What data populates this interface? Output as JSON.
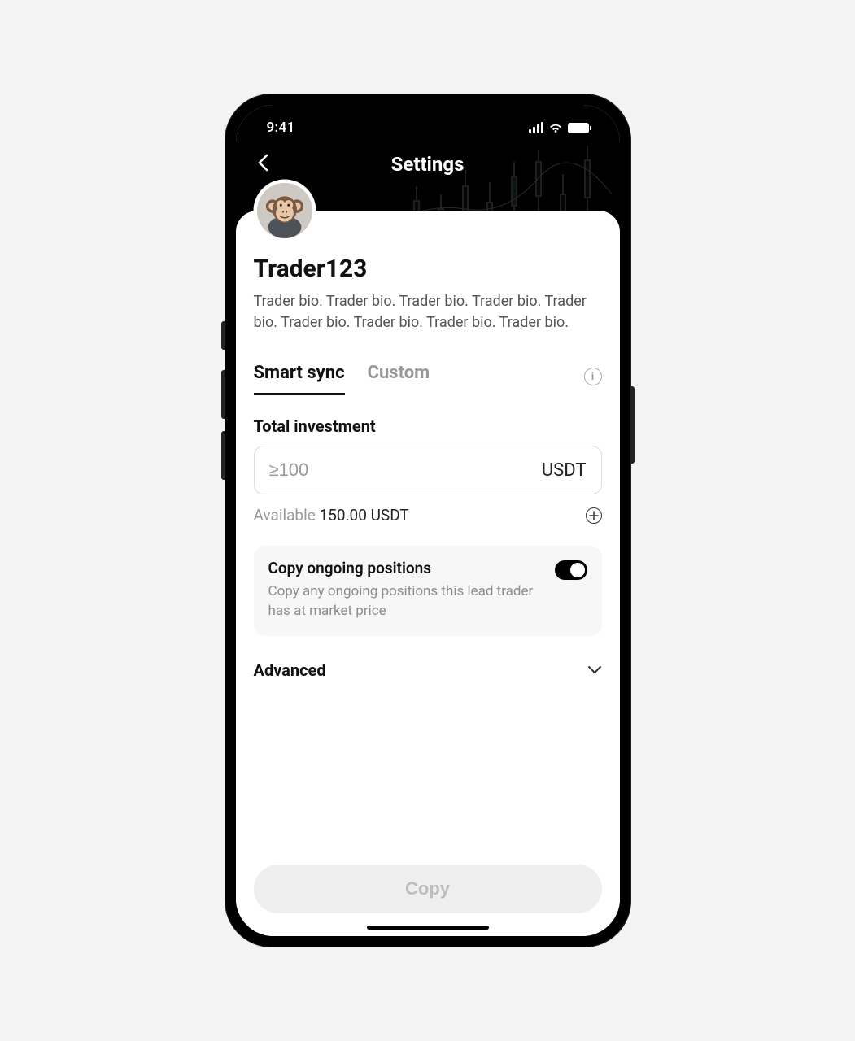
{
  "status": {
    "time": "9:41"
  },
  "header": {
    "title": "Settings"
  },
  "profile": {
    "name": "Trader123",
    "bio": "Trader bio. Trader bio. Trader bio. Trader bio. Trader bio. Trader bio. Trader bio. Trader bio. Trader bio.",
    "avatar_desc": "monkey-avatar"
  },
  "tabs": {
    "smart_sync": "Smart sync",
    "custom": "Custom",
    "active": "smart_sync"
  },
  "investment": {
    "label": "Total investment",
    "placeholder": "≥100",
    "value": "",
    "currency": "USDT",
    "available_label": "Available",
    "available_value": "150.00 USDT"
  },
  "copy_positions": {
    "title": "Copy ongoing positions",
    "subtitle": "Copy any ongoing positions this lead trader has at market price",
    "enabled": true
  },
  "advanced": {
    "label": "Advanced"
  },
  "footer": {
    "copy_button": "Copy"
  }
}
